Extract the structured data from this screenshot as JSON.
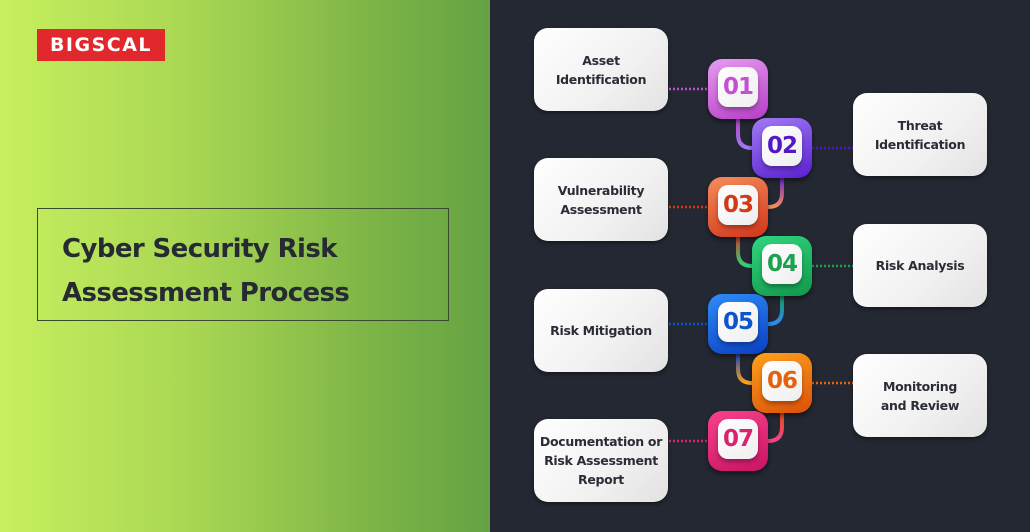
{
  "brand": {
    "logo_text": "BIGSCAL",
    "logo_color": "#e0282d"
  },
  "title": "Cyber Security Risk\nAssessment Process",
  "steps": [
    {
      "number": "01",
      "label": "Asset Identification",
      "side": "left",
      "color": "#c44fd1",
      "gradient": [
        "#e79bf0",
        "#b53ec6"
      ]
    },
    {
      "number": "02",
      "label": "Threat Identification",
      "side": "right",
      "color": "#5417c6",
      "gradient": [
        "#a07af5",
        "#5a1fd0"
      ]
    },
    {
      "number": "03",
      "label": "Vulnerability Assessment",
      "side": "left",
      "color": "#d23a17",
      "gradient": [
        "#f58d5b",
        "#d2341a"
      ]
    },
    {
      "number": "04",
      "label": "Risk Analysis",
      "side": "right",
      "color": "#1aa24e",
      "gradient": [
        "#30d57f",
        "#12984a"
      ]
    },
    {
      "number": "05",
      "label": "Risk Mitigation",
      "side": "left",
      "color": "#0d55cc",
      "gradient": [
        "#2f8cf7",
        "#0a3fc1"
      ]
    },
    {
      "number": "06",
      "label": "Monitoring and Review",
      "side": "right",
      "color": "#e2620d",
      "gradient": [
        "#ffa21c",
        "#dc4f0a"
      ]
    },
    {
      "number": "07",
      "label": "Documentation or Risk Assessment Report",
      "side": "left",
      "color": "#d8246f",
      "gradient": [
        "#f7428a",
        "#c91464"
      ]
    }
  ]
}
